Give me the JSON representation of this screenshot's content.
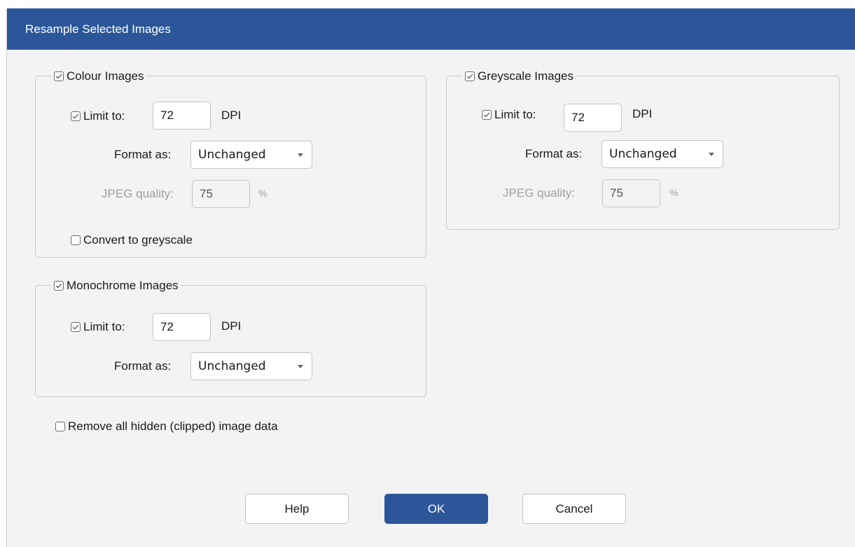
{
  "dialog": {
    "title": "Resample Selected Images"
  },
  "colour": {
    "group_label": "Colour Images",
    "group_checked": true,
    "limit_label": "Limit to:",
    "limit_checked": true,
    "dpi_value": "72",
    "dpi_unit": "DPI",
    "format_label": "Format as:",
    "format_value": "Unchanged",
    "jpeg_label": "JPEG quality:",
    "jpeg_value": "75",
    "jpeg_unit": "%",
    "greyscale_label": "Convert to greyscale",
    "greyscale_checked": false
  },
  "greyscale": {
    "group_label": "Greyscale Images",
    "group_checked": true,
    "limit_label": "Limit to:",
    "limit_checked": true,
    "dpi_value": "72",
    "dpi_unit": "DPI",
    "format_label": "Format as:",
    "format_value": "Unchanged",
    "jpeg_label": "JPEG quality:",
    "jpeg_value": "75",
    "jpeg_unit": "%"
  },
  "monochrome": {
    "group_label": "Monochrome Images",
    "group_checked": true,
    "limit_label": "Limit to:",
    "limit_checked": true,
    "dpi_value": "72",
    "dpi_unit": "DPI",
    "format_label": "Format as:",
    "format_value": "Unchanged"
  },
  "remove_hidden": {
    "label": "Remove all hidden (clipped) image data",
    "checked": false
  },
  "buttons": {
    "help": "Help",
    "ok": "OK",
    "cancel": "Cancel"
  },
  "colors": {
    "accent": "#2b579a",
    "dialog_bg": "#f3f3f3"
  }
}
